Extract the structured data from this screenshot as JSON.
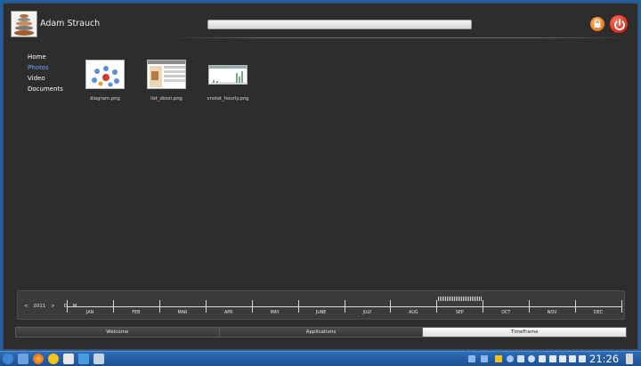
{
  "header": {
    "user_name": "Adam Strauch",
    "search_value": "",
    "lock_icon": "lock-icon",
    "power_icon": "power-icon"
  },
  "nav": {
    "items": [
      {
        "label": "Home",
        "active": false
      },
      {
        "label": "Photos",
        "active": true
      },
      {
        "label": "Video",
        "active": false
      },
      {
        "label": "Documents",
        "active": false
      }
    ]
  },
  "files": [
    {
      "name": "diagram.png"
    },
    {
      "name": "list_zbozi.png"
    },
    {
      "name": "vnstat_hourly.png"
    }
  ],
  "timeline": {
    "controls": {
      "prev": "<",
      "year": "2011",
      "next": ">",
      "day": "D",
      "month": "M"
    },
    "months": [
      "JAN",
      "FEB",
      "MAR",
      "APR",
      "MAY",
      "JUNE",
      "JULY",
      "AUG",
      "SEP",
      "OCT",
      "NOV",
      "DEC"
    ]
  },
  "tabs": [
    {
      "label": "Welcome",
      "active": false
    },
    {
      "label": "Applications",
      "active": false
    },
    {
      "label": "TimeFrame",
      "active": true
    }
  ],
  "taskbar": {
    "clock": "21:26",
    "colors": {
      "bar": "#2e6db8",
      "active_tab": "#ffffff",
      "nav_active": "#6da8ff"
    }
  }
}
